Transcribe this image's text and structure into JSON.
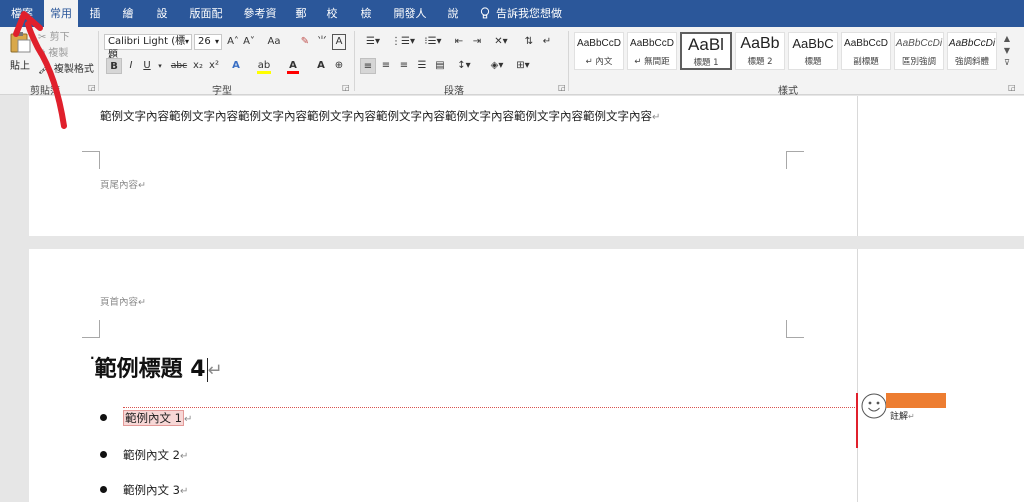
{
  "ribbon": {
    "tabs": [
      {
        "label": "檔案"
      },
      {
        "label": "常用"
      },
      {
        "label": "插入"
      },
      {
        "label": "繪圖"
      },
      {
        "label": "設計"
      },
      {
        "label": "版面配置"
      },
      {
        "label": "參考資料"
      },
      {
        "label": "郵件"
      },
      {
        "label": "校閱"
      },
      {
        "label": "檢視"
      },
      {
        "label": "開發人員"
      },
      {
        "label": "說明"
      }
    ],
    "tell_me": "告訴我您想做什麼",
    "clipboard": {
      "paste": "貼上",
      "cut": "剪下",
      "copy": "複製",
      "format_painter": "複製格式",
      "label": "剪貼簿"
    },
    "font": {
      "name": "Calibri Light (標題",
      "size": "26",
      "label": "字型",
      "bold": "B",
      "italic": "I",
      "underline": "U",
      "strike": "abc",
      "subscript": "x₂",
      "superscript": "x²",
      "grow": "A˄",
      "shrink": "A˅",
      "case": "Aa",
      "color_letter": "A"
    },
    "paragraph": {
      "label": "段落"
    },
    "styles": {
      "label": "樣式",
      "items": [
        {
          "sample": "AaBbCcD",
          "name": "↵ 內文"
        },
        {
          "sample": "AaBbCcD",
          "name": "↵ 無間距"
        },
        {
          "sample": "AaBl",
          "name": "標題 1"
        },
        {
          "sample": "AaBb",
          "name": "標題 2"
        },
        {
          "sample": "AaBbC",
          "name": "標題"
        },
        {
          "sample": "AaBbCcD",
          "name": "副標題"
        },
        {
          "sample": "AaBbCcDi",
          "name": "區別強調"
        },
        {
          "sample": "AaBbCcDi",
          "name": "強調斜體"
        }
      ]
    },
    "colors": {
      "tab_bar": "#2b579a",
      "ribbon_bg": "#f3f3f3",
      "highlight_yellow": "#ffff00",
      "font_red": "#ff0000",
      "annotation_red": "#e0202c"
    }
  },
  "document": {
    "page1": {
      "body_text": "範例文字內容範例文字內容範例文字內容範例文字內容範例文字內容範例文字內容範例文字內容範例文字內容",
      "footer": "頁尾內容"
    },
    "page2": {
      "header": "頁首內容",
      "heading": "範例標題 4",
      "list": [
        {
          "text": "範例內文 1"
        },
        {
          "text": "範例內文 2"
        },
        {
          "text": "範例內文 3"
        }
      ]
    },
    "comment": {
      "text": "註解",
      "marker_color": "#ed7d31"
    },
    "paragraph_mark": "↵"
  }
}
